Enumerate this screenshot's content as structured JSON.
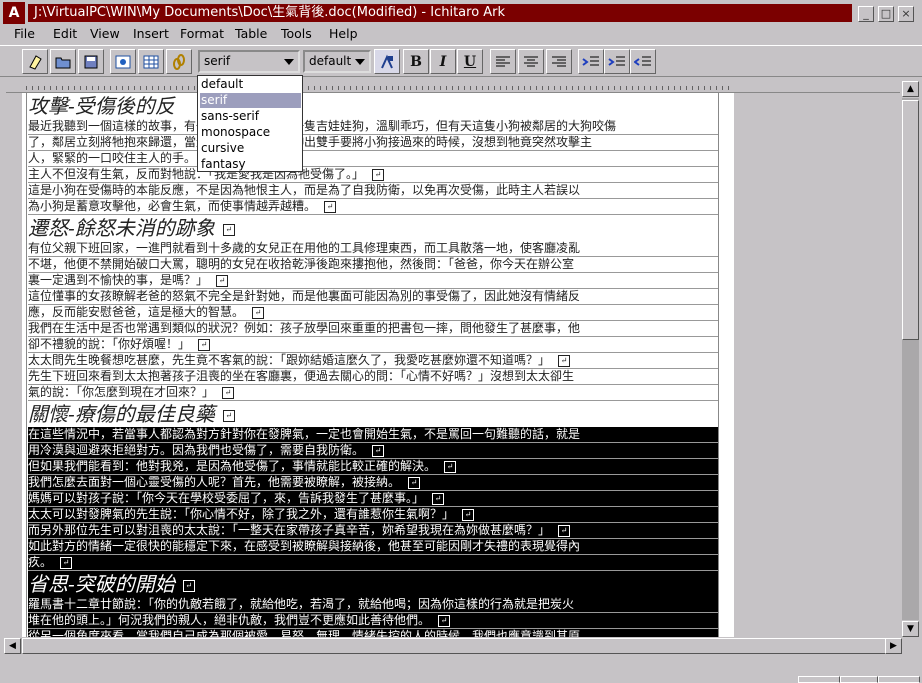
{
  "window": {
    "title": "J:\\VirtualPC\\WIN\\My Documents\\Doc\\生氣背後.doc(Modified) - Ichitaro Ark",
    "app_icon_label": "A"
  },
  "menu": {
    "items": [
      "File",
      "Edit",
      "View",
      "Insert",
      "Format",
      "Table",
      "Tools",
      "Help"
    ]
  },
  "toolbar": {
    "font_family_value": "serif",
    "font_size_value": "default",
    "bold_label": "B",
    "italic_label": "I",
    "underline_label": "U"
  },
  "font_dropdown": {
    "options": [
      "default",
      "serif",
      "sans-serif",
      "monospace",
      "cursive",
      "fantasy"
    ],
    "selected": "serif"
  },
  "document": {
    "lines": [
      {
        "type": "head",
        "text": "攻擊-受傷後的反",
        "ret": false,
        "inv": false
      },
      {
        "type": "body",
        "text": "最近我聽到一個這樣的故事，有一位朋友，他養了一隻吉娃娃狗，溫馴乖巧，但有天這隻小狗被鄰居的大狗咬傷",
        "ret": false,
        "inv": false
      },
      {
        "type": "body",
        "text": "了，鄰居立刻將牠抱來歸還，當這位朋友很心疼的伸出雙手要將小狗接過來的時候，沒想到牠竟突然攻擊主",
        "ret": false,
        "inv": false
      },
      {
        "type": "body",
        "text": "人，緊緊的一口咬住主人的手。",
        "ret": false,
        "inv": false
      },
      {
        "type": "body",
        "text": "主人不但沒有生氣，反而對牠說：「我是愛我是因為牠受傷了。」",
        "ret": true,
        "inv": false
      },
      {
        "type": "body",
        "text": "這是小狗在受傷時的本能反應，不是因為牠恨主人，而是為了自我防衛，以免再次受傷，此時主人若誤以",
        "ret": false,
        "inv": false
      },
      {
        "type": "body",
        "text": "為小狗是蓄意攻擊他，必會生氣，而使事情越弄越糟。",
        "ret": true,
        "inv": false
      },
      {
        "type": "head",
        "text": "遷怒-餘怒未消的跡象",
        "ret": true,
        "inv": false
      },
      {
        "type": "body",
        "text": "有位父親下班回家，一進門就看到十多歲的女兒正在用他的工具修理東西，而工具散落一地，使客廳凌亂",
        "ret": false,
        "inv": false
      },
      {
        "type": "body",
        "text": "不堪，他便不禁開始破口大罵，聰明的女兒在收拾乾淨後跑來摟抱他，然後問：「爸爸，你今天在辦公室",
        "ret": false,
        "inv": false
      },
      {
        "type": "body",
        "text": "裏一定遇到不愉快的事，是嗎？」",
        "ret": true,
        "inv": false
      },
      {
        "type": "body",
        "text": "這位懂事的女孩瞭解老爸的怒氣不完全是針對她，而是他裏面可能因為別的事受傷了，因此她沒有情緒反",
        "ret": false,
        "inv": false
      },
      {
        "type": "body",
        "text": "應，反而能安慰爸爸，這是極大的智慧。",
        "ret": true,
        "inv": false
      },
      {
        "type": "body",
        "text": "我們在生活中是否也常遇到類似的狀況？例如：孩子放學回來重重的把書包一摔，問他發生了甚麼事，他",
        "ret": false,
        "inv": false
      },
      {
        "type": "body",
        "text": "卻不禮貌的說：「你好煩喔！」",
        "ret": true,
        "inv": false
      },
      {
        "type": "body",
        "text": "太太問先生晚餐想吃甚麼，先生竟不客氣的說：「跟妳結婚這麼久了，我愛吃甚麼妳還不知道嗎？」",
        "ret": true,
        "inv": false
      },
      {
        "type": "body",
        "text": "先生下班回來看到太太抱著孩子沮喪的坐在客廳裏，便過去關心的問：「心情不好嗎？」沒想到太太卻生",
        "ret": false,
        "inv": false
      },
      {
        "type": "body",
        "text": "氣的說：「你怎麼到現在才回來？」",
        "ret": true,
        "inv": false
      },
      {
        "type": "head",
        "text": "關懷-療傷的最佳良藥",
        "ret": true,
        "inv": false
      },
      {
        "type": "body",
        "text": "在這些情況中，若當事人都認為對方針對你在發脾氣，一定也會開始生氣，不是罵回一句難聽的話，就是",
        "ret": false,
        "inv": true
      },
      {
        "type": "body",
        "text": "用冷漠與迴避來拒絕對方。因為我們也受傷了，需要自我防衛。",
        "ret": true,
        "inv": true
      },
      {
        "type": "body",
        "text": "但如果我們能看到：他對我兇，是因為他受傷了，事情就能比較正確的解決。",
        "ret": true,
        "inv": true
      },
      {
        "type": "body",
        "text": "我們怎麼去面對一個心靈受傷的人呢？首先，他需要被瞭解，被接納。",
        "ret": true,
        "inv": true
      },
      {
        "type": "body",
        "text": "媽媽可以對孩子說：「你今天在學校受委屈了，來，告訴我發生了甚麼事。」",
        "ret": true,
        "inv": true
      },
      {
        "type": "body",
        "text": "太太可以對發脾氣的先生說：「你心情不好，除了我之外，還有誰惹你生氣啊？」",
        "ret": true,
        "inv": true
      },
      {
        "type": "body",
        "text": "而另外那位先生可以對沮喪的太太說：「一整天在家帶孩子真辛苦，妳希望我現在為妳做甚麼嗎？」",
        "ret": true,
        "inv": true
      },
      {
        "type": "body",
        "text": "如此對方的情緒一定很快的能穩定下來，在感受到被瞭解與接納後，他甚至可能因剛才失禮的表現覺得內",
        "ret": false,
        "inv": true
      },
      {
        "type": "body",
        "text": "疚。",
        "ret": true,
        "inv": true
      },
      {
        "type": "head",
        "text": "省思-突破的開始",
        "ret": true,
        "inv": true
      },
      {
        "type": "body",
        "text": "羅馬書十二章廿節說：「你的仇敵若餓了，就給他吃，若渴了，就給他喝；因為你這樣的行為就是把炭火",
        "ret": false,
        "inv": true
      },
      {
        "type": "body",
        "text": "堆在他的頭上。」何況我們的親人，絕非仇敵，我們豈不更應如此善待他們。",
        "ret": true,
        "inv": true
      },
      {
        "type": "body",
        "text": "從另一個角度來看，當我們自己成為那個被愛、易怒、無理、情緒失控的人的時候，我們也應意識到其原",
        "ret": false,
        "inv": true
      }
    ]
  },
  "colors": {
    "title_bar": "#7b0000",
    "dropdown_highlight": "#9c9ebd",
    "chrome": "#c6c3c6"
  }
}
